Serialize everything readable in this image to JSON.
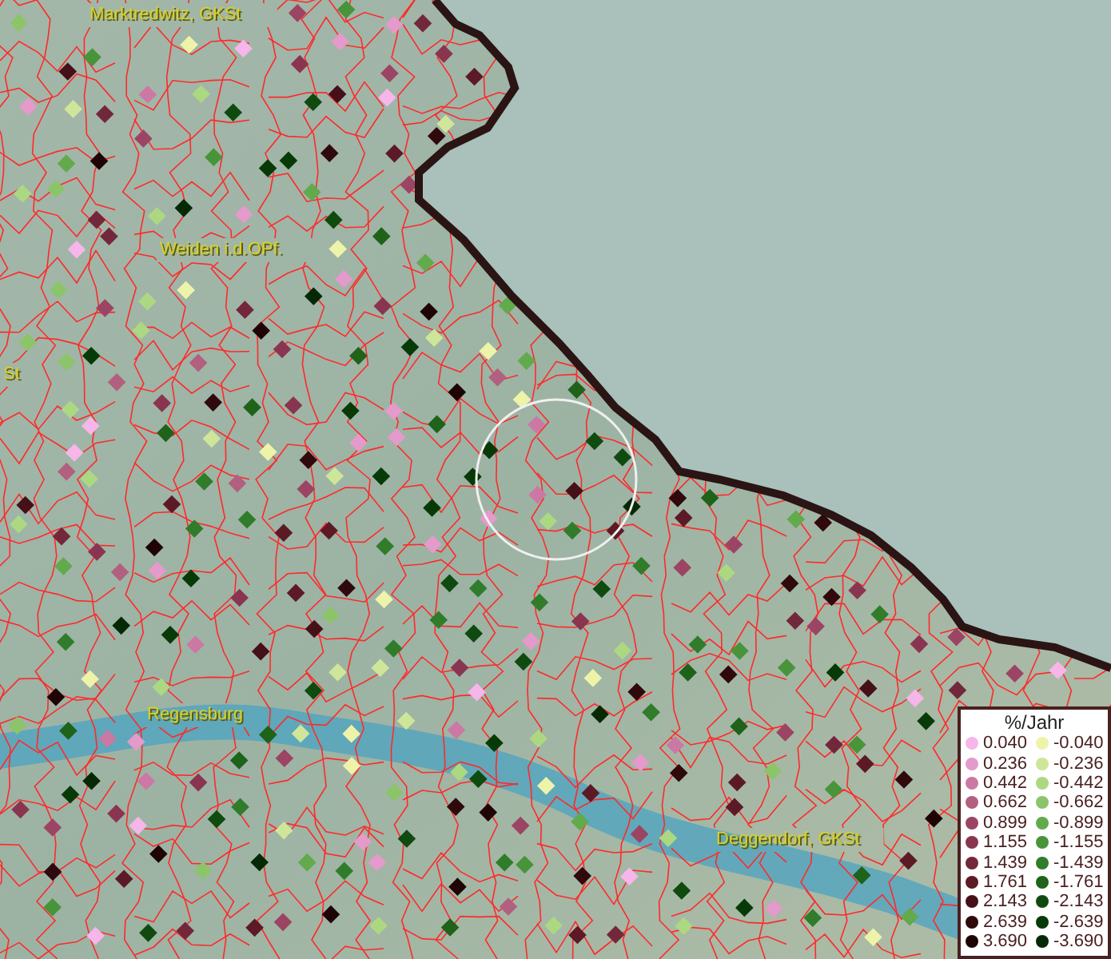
{
  "map": {
    "labels": [
      {
        "text": "Marktredwitz, GKSt"
      },
      {
        "text": "Weiden i.d.OPf."
      },
      {
        "text": "St"
      },
      {
        "text": "Regensburg"
      },
      {
        "text": "Deggendorf, GKSt"
      }
    ]
  },
  "legend": {
    "title": "%/Jahr",
    "items": [
      {
        "label": "0.040",
        "color": "#f6b6ea"
      },
      {
        "label": "-0.040",
        "color": "#eef3aa"
      },
      {
        "label": "0.236",
        "color": "#e49acb"
      },
      {
        "label": "-0.236",
        "color": "#cfe69a"
      },
      {
        "label": "0.442",
        "color": "#cc78a4"
      },
      {
        "label": "-0.442",
        "color": "#acd882"
      },
      {
        "label": "0.662",
        "color": "#b2607f"
      },
      {
        "label": "-0.662",
        "color": "#8cc46a"
      },
      {
        "label": "0.899",
        "color": "#9c4463"
      },
      {
        "label": "-0.899",
        "color": "#62aa4c"
      },
      {
        "label": "1.155",
        "color": "#8a3550"
      },
      {
        "label": "-1.155",
        "color": "#48943a"
      },
      {
        "label": "1.439",
        "color": "#72283a"
      },
      {
        "label": "-1.439",
        "color": "#317c2a"
      },
      {
        "label": "1.761",
        "color": "#5c1a26"
      },
      {
        "label": "-1.761",
        "color": "#1f6219"
      },
      {
        "label": "2.143",
        "color": "#461019"
      },
      {
        "label": "-2.143",
        "color": "#0f4b0f"
      },
      {
        "label": "2.639",
        "color": "#30090c"
      },
      {
        "label": "-2.639",
        "color": "#083a08"
      },
      {
        "label": "3.690",
        "color": "#1f0405"
      },
      {
        "label": "-3.690",
        "color": "#052905"
      }
    ]
  }
}
